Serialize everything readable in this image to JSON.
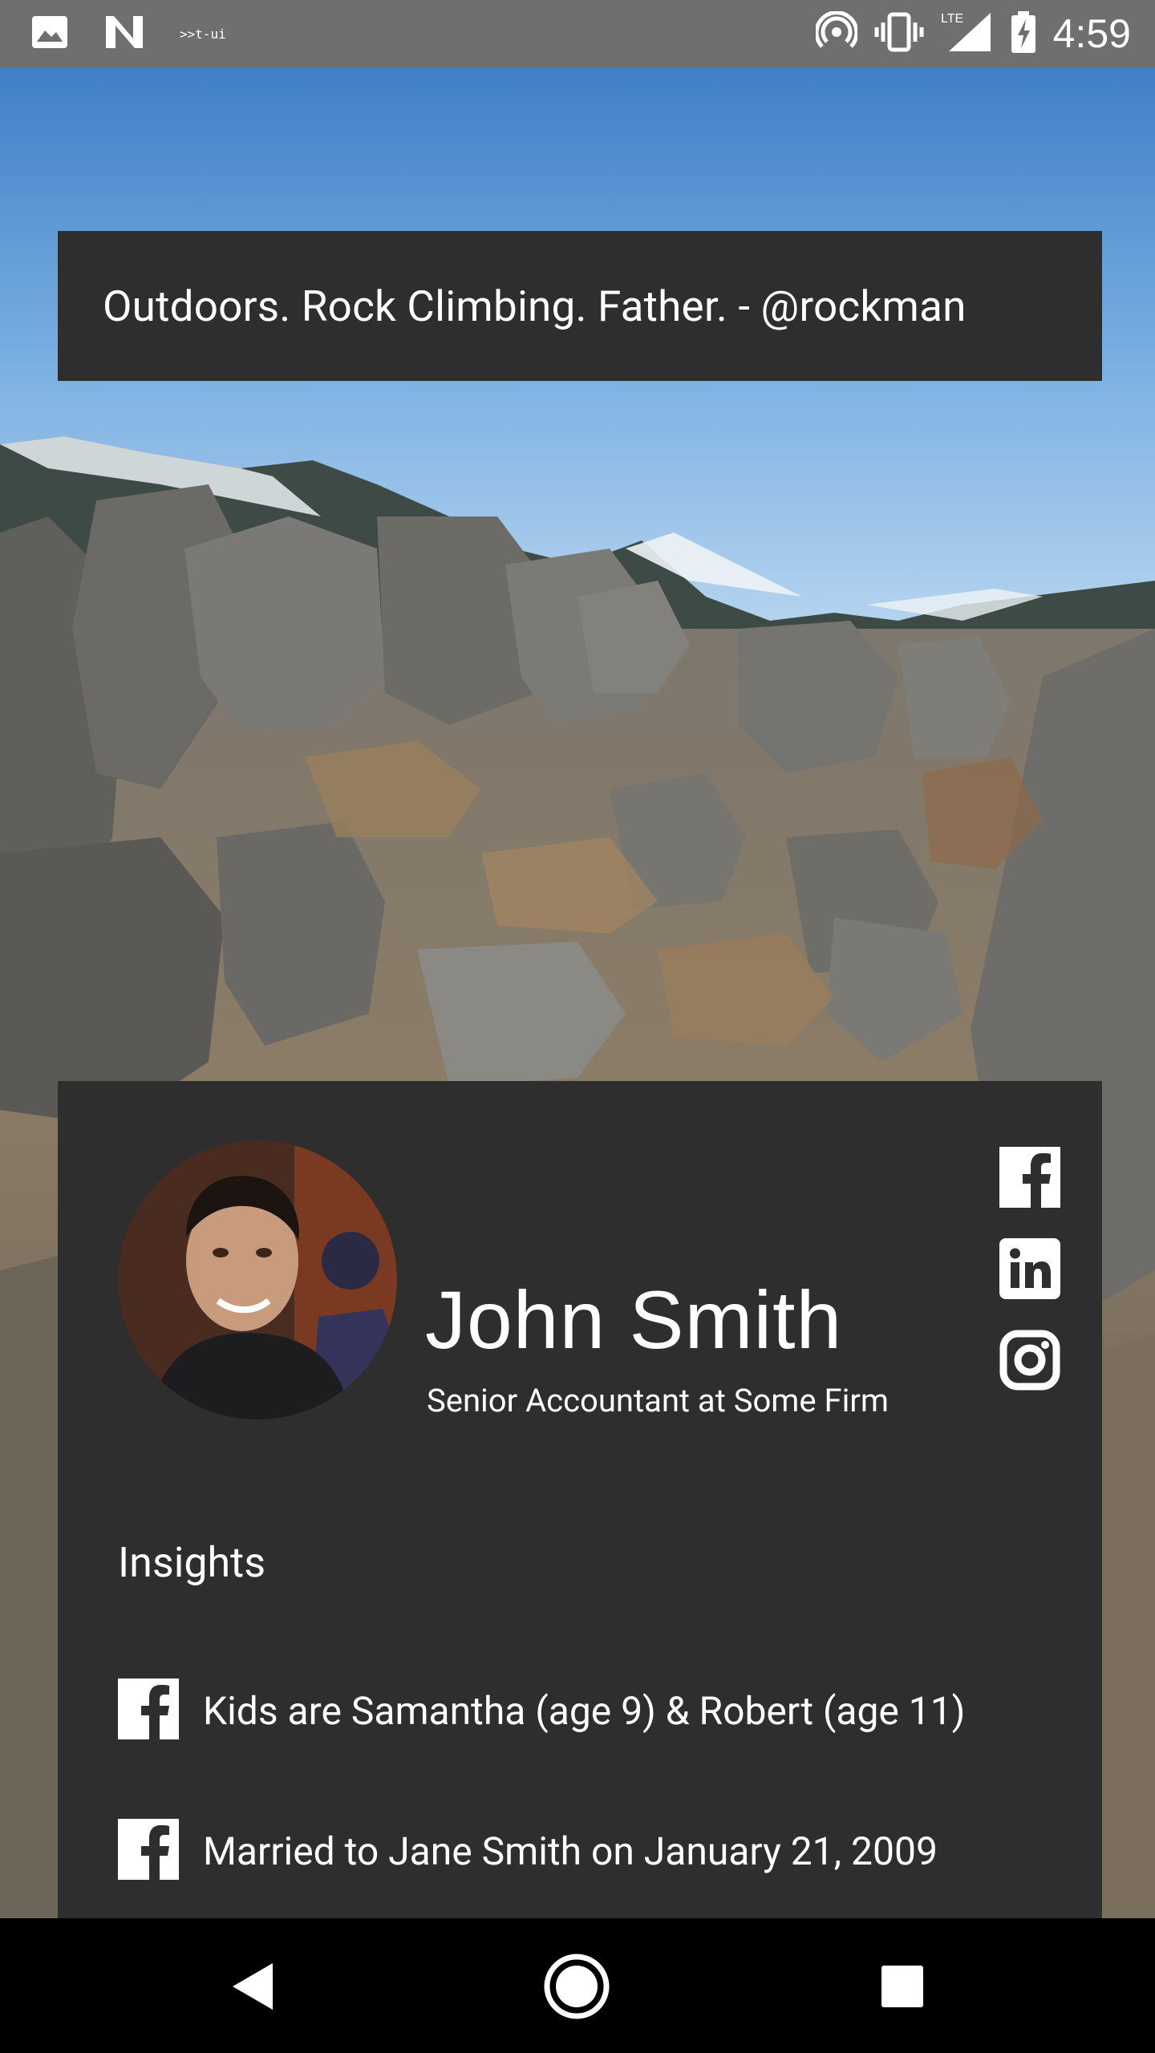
{
  "status_bar": {
    "time": "4:59",
    "network": "LTE",
    "dev_label": ">>t-ui",
    "icons": [
      "image-icon",
      "n-logo-icon",
      "hotspot-icon",
      "vibrate-icon",
      "signal-icon",
      "battery-charging-icon"
    ]
  },
  "hero": {
    "quote": "Outdoors. Rock Climbing. Father. - @rockman"
  },
  "profile": {
    "name": "John Smith",
    "title": "Senior Accountant at Some Firm",
    "social": [
      "facebook-icon",
      "linkedin-icon",
      "instagram-icon"
    ]
  },
  "insights": {
    "heading": "Insights",
    "items": [
      {
        "source": "facebook",
        "text": "Kids are Samantha (age 9) & Robert (age 11)"
      },
      {
        "source": "facebook",
        "text": "Married to Jane Smith on January 21, 2009"
      }
    ]
  },
  "nav": {
    "buttons": [
      "back-button",
      "home-button",
      "recents-button"
    ]
  },
  "colors": {
    "status_bar": "#6f6f6f",
    "card": "#2e2e2e",
    "nav_bar": "#000000",
    "text": "#ffffff"
  }
}
